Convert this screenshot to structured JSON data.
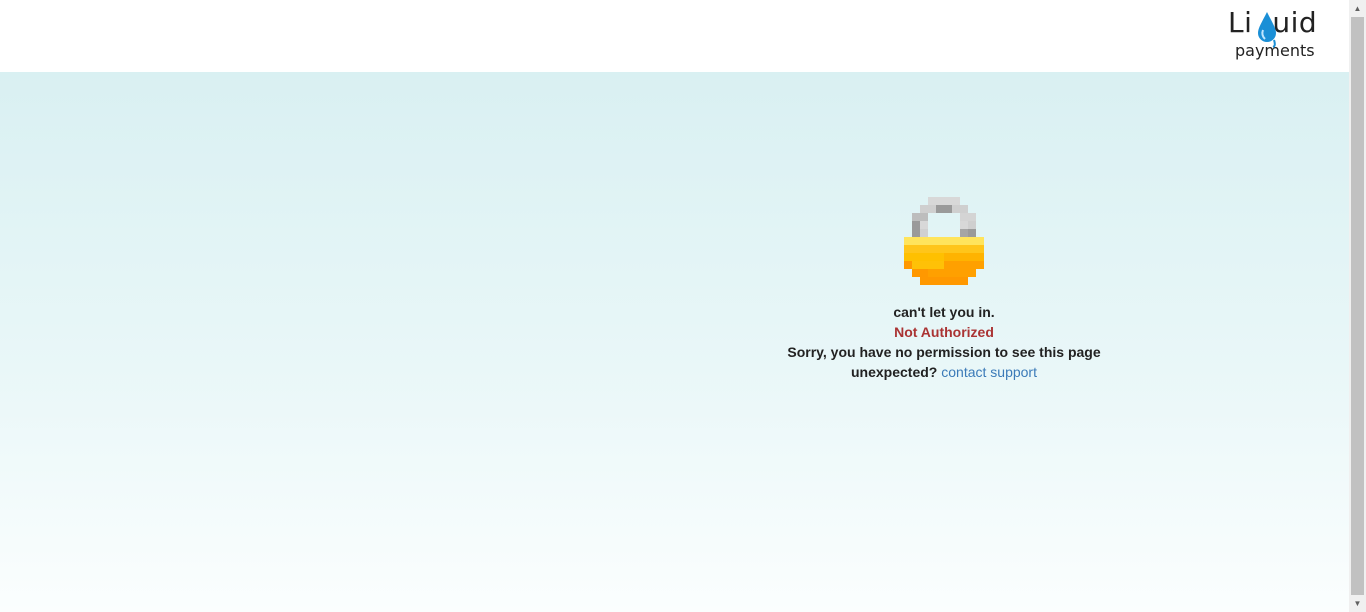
{
  "brand": {
    "logo_prefix": "Li",
    "logo_suffix": "uid",
    "logo_word": "Liquid",
    "logo_sub": "payments"
  },
  "message": {
    "headline": "can't let you in.",
    "status": "Not Authorized",
    "detail": "Sorry, you have no permission to see this page",
    "prompt": "unexpected?",
    "support_link": "contact support"
  },
  "icons": {
    "lock": "lock-icon",
    "drop": "water-drop-icon"
  },
  "colors": {
    "status": "#aa3333",
    "link": "#3b7ab8",
    "bg_top": "#d9f0f2",
    "bg_bottom": "#fbfefe",
    "lock_body": "#ffc107",
    "lock_shackle": "#a0a0a0"
  }
}
